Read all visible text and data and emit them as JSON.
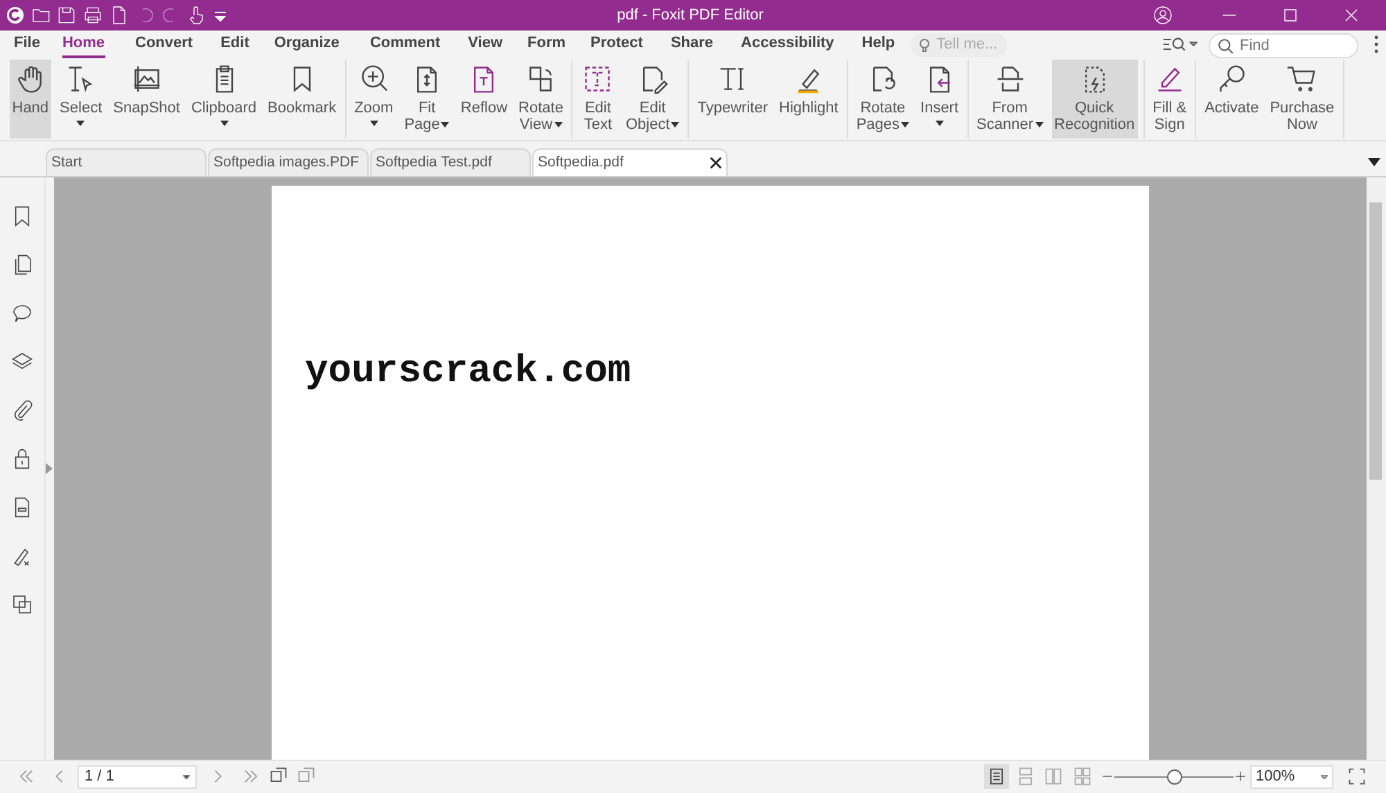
{
  "window": {
    "title": "pdf - Foxit PDF Editor"
  },
  "menu_tabs": [
    {
      "label": "File",
      "selected": false
    },
    {
      "label": "Home",
      "selected": true
    },
    {
      "label": "Convert",
      "selected": false
    },
    {
      "label": "Edit",
      "selected": false
    },
    {
      "label": "Organize",
      "selected": false
    },
    {
      "label": "Comment",
      "selected": false
    },
    {
      "label": "View",
      "selected": false
    },
    {
      "label": "Form",
      "selected": false
    },
    {
      "label": "Protect",
      "selected": false
    },
    {
      "label": "Share",
      "selected": false
    },
    {
      "label": "Accessibility",
      "selected": false
    },
    {
      "label": "Help",
      "selected": false
    }
  ],
  "tell_me": {
    "placeholder": "Tell me..."
  },
  "find": {
    "placeholder": "Find"
  },
  "ribbon_groups": [
    {
      "buttons": [
        {
          "label": "Hand",
          "dropdown": false,
          "selected": true
        },
        {
          "label": "Select",
          "dropdown": true,
          "selected": false
        },
        {
          "label": "SnapShot",
          "dropdown": false,
          "selected": false
        },
        {
          "label": "Clipboard",
          "dropdown": true,
          "selected": false
        },
        {
          "label": "Bookmark",
          "dropdown": false,
          "selected": false
        }
      ]
    },
    {
      "buttons": [
        {
          "label": "Zoom",
          "dropdown": true,
          "selected": false
        },
        {
          "label": "Fit\nPage",
          "dropdown": true,
          "selected": false
        },
        {
          "label": "Reflow",
          "dropdown": false,
          "selected": false
        },
        {
          "label": "Rotate\nView",
          "dropdown": true,
          "selected": false
        }
      ]
    },
    {
      "buttons": [
        {
          "label": "Edit\nText",
          "dropdown": false,
          "selected": false
        },
        {
          "label": "Edit\nObject",
          "dropdown": true,
          "selected": false
        }
      ]
    },
    {
      "buttons": [
        {
          "label": "Typewriter",
          "dropdown": false,
          "selected": false
        },
        {
          "label": "Highlight",
          "dropdown": false,
          "selected": false
        }
      ]
    },
    {
      "buttons": [
        {
          "label": "Rotate\nPages",
          "dropdown": true,
          "selected": false
        },
        {
          "label": "Insert",
          "dropdown": true,
          "selected": false
        }
      ]
    },
    {
      "buttons": [
        {
          "label": "From\nScanner",
          "dropdown": true,
          "selected": false
        },
        {
          "label": "Quick\nRecognition",
          "dropdown": false,
          "selected": true
        }
      ]
    },
    {
      "buttons": [
        {
          "label": "Fill &\nSign",
          "dropdown": false,
          "selected": false
        }
      ]
    },
    {
      "buttons": [
        {
          "label": "Activate",
          "dropdown": false,
          "selected": false
        },
        {
          "label": "Purchase\nNow",
          "dropdown": false,
          "selected": false
        }
      ]
    }
  ],
  "doc_tabs": [
    {
      "label": "Start",
      "selected": false,
      "closable": false
    },
    {
      "label": "Softpedia images.PDF",
      "selected": false,
      "closable": false
    },
    {
      "label": "Softpedia Test.pdf",
      "selected": false,
      "closable": false
    },
    {
      "label": "Softpedia.pdf",
      "selected": true,
      "closable": true
    }
  ],
  "document": {
    "text": "yourscrack.com"
  },
  "status_bar": {
    "page": "1 / 1",
    "zoom": "100%",
    "zoom_slider": {
      "level": 0.5
    },
    "layouts": [
      {
        "selected": true
      },
      {
        "selected": false
      },
      {
        "selected": false
      },
      {
        "selected": false
      }
    ]
  }
}
